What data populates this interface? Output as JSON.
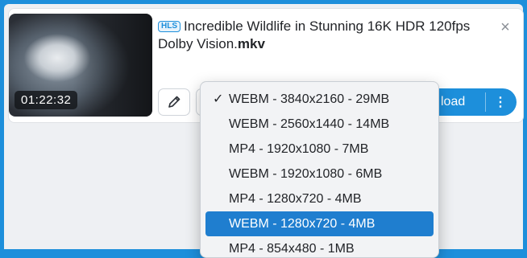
{
  "item": {
    "badge": "HLS",
    "title_main": "Incredible Wildlife in Stunning 16K HDR 120fps Dolby Vision.",
    "title_ext": "mkv",
    "duration": "01:22:32",
    "close_symbol": "×"
  },
  "actions": {
    "download_label": "load",
    "more_symbol": "⋮"
  },
  "format_menu": {
    "check_symbol": "✓",
    "selected_index": 0,
    "highlighted_index": 5,
    "options": [
      "WEBM - 3840x2160 - 29MB",
      "WEBM - 2560x1440 - 14MB",
      "MP4 - 1920x1080 - 7MB",
      "WEBM - 1920x1080 - 6MB",
      "MP4 - 1280x720 - 4MB",
      "WEBM - 1280x720 - 4MB",
      "MP4 - 854x480 - 1MB"
    ]
  },
  "colors": {
    "accent": "#1d8fdb",
    "highlight": "#1f7ecf",
    "background": "#eef0f3"
  }
}
